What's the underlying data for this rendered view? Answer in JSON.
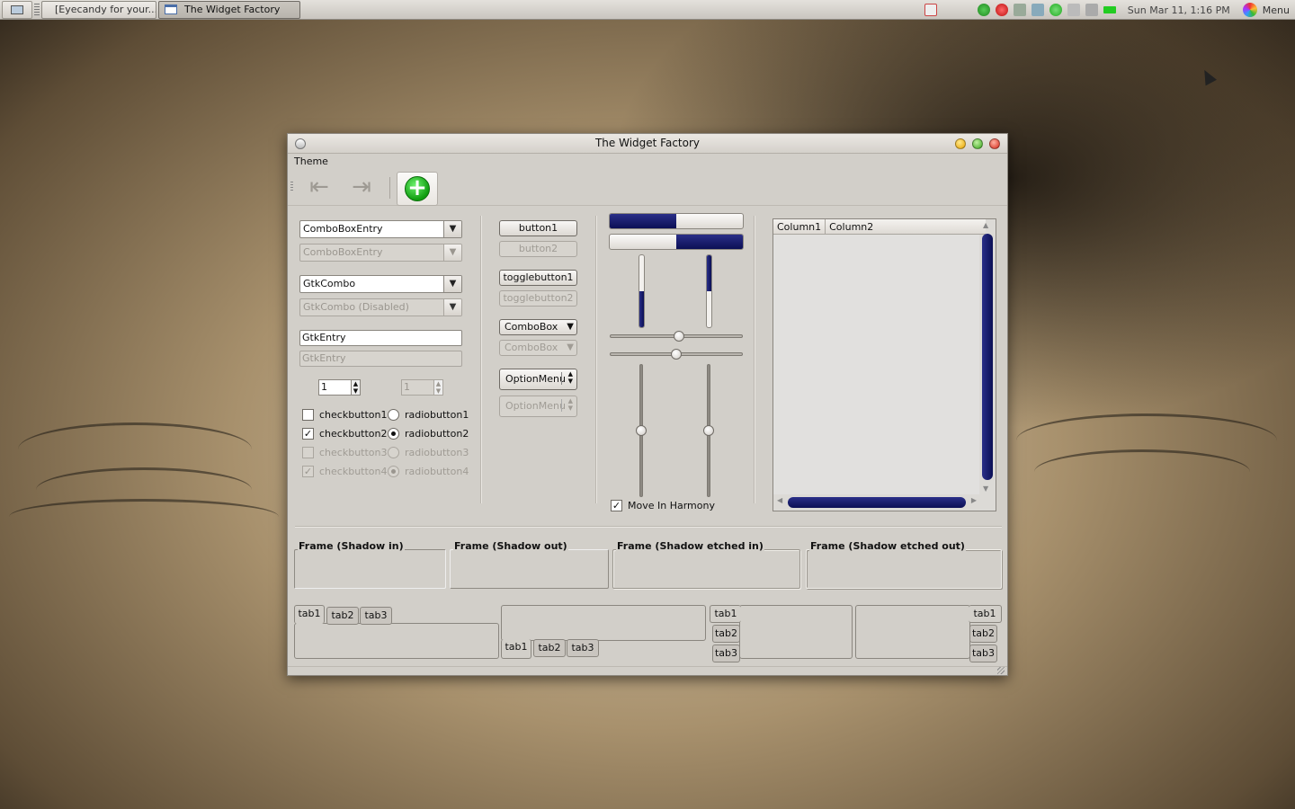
{
  "panel": {
    "tasks": [
      {
        "label": "[Eyecandy for your..."
      },
      {
        "label": "The Widget Factory"
      }
    ],
    "clock": "Sun Mar 11,  1:16 PM",
    "menu_label": "Menu"
  },
  "window": {
    "title": "The Widget Factory",
    "menu": {
      "theme": "Theme"
    },
    "col1": {
      "combo_entry": "ComboBoxEntry",
      "combo_entry_disabled": "ComboBoxEntry",
      "gtk_combo": "GtkCombo",
      "gtk_combo_disabled": "GtkCombo (Disabled)",
      "entry": "GtkEntry",
      "entry_disabled_placeholder": "GtkEntry",
      "spin_value": "1",
      "spin_disabled_value": "1",
      "checks": [
        {
          "label": "checkbutton1",
          "checked": false
        },
        {
          "label": "checkbutton2",
          "checked": true
        },
        {
          "label": "checkbutton3",
          "checked": false
        },
        {
          "label": "checkbutton4",
          "checked": true
        }
      ],
      "radios": [
        {
          "label": "radiobutton1",
          "selected": false
        },
        {
          "label": "radiobutton2",
          "selected": true
        },
        {
          "label": "radiobutton3",
          "selected": false
        },
        {
          "label": "radiobutton4",
          "selected": true
        }
      ]
    },
    "col2": {
      "button1": "button1",
      "button2": "button2",
      "toggle1": "togglebutton1",
      "toggle2": "togglebutton2",
      "combobox": "ComboBox",
      "combobox_disabled": "ComboBox",
      "optionmenu": "OptionMenu",
      "optionmenu_disabled": "OptionMenu"
    },
    "col3": {
      "hprogress1_fraction": 0.5,
      "hprogress2_fraction": 0.5,
      "vprogress1_fraction": 0.5,
      "vprogress2_fraction": 0.5,
      "hscale1_fraction": 0.52,
      "hscale2_fraction": 0.5,
      "vscale1_fraction": 0.5,
      "vscale2_fraction": 0.5,
      "move_in_harmony": "Move In Harmony"
    },
    "tree": {
      "columns": [
        "Column1",
        "Column2"
      ]
    },
    "frames": [
      {
        "label": "Frame (Shadow in)"
      },
      {
        "label": "Frame (Shadow out)"
      },
      {
        "label": "Frame (Shadow etched in)"
      },
      {
        "label": "Frame (Shadow etched out)"
      }
    ],
    "notebooks": {
      "tabs": [
        "tab1",
        "tab2",
        "tab3"
      ]
    }
  },
  "colors": {
    "accent": "#0b0f55",
    "window_bg": "#d2cfc9"
  }
}
